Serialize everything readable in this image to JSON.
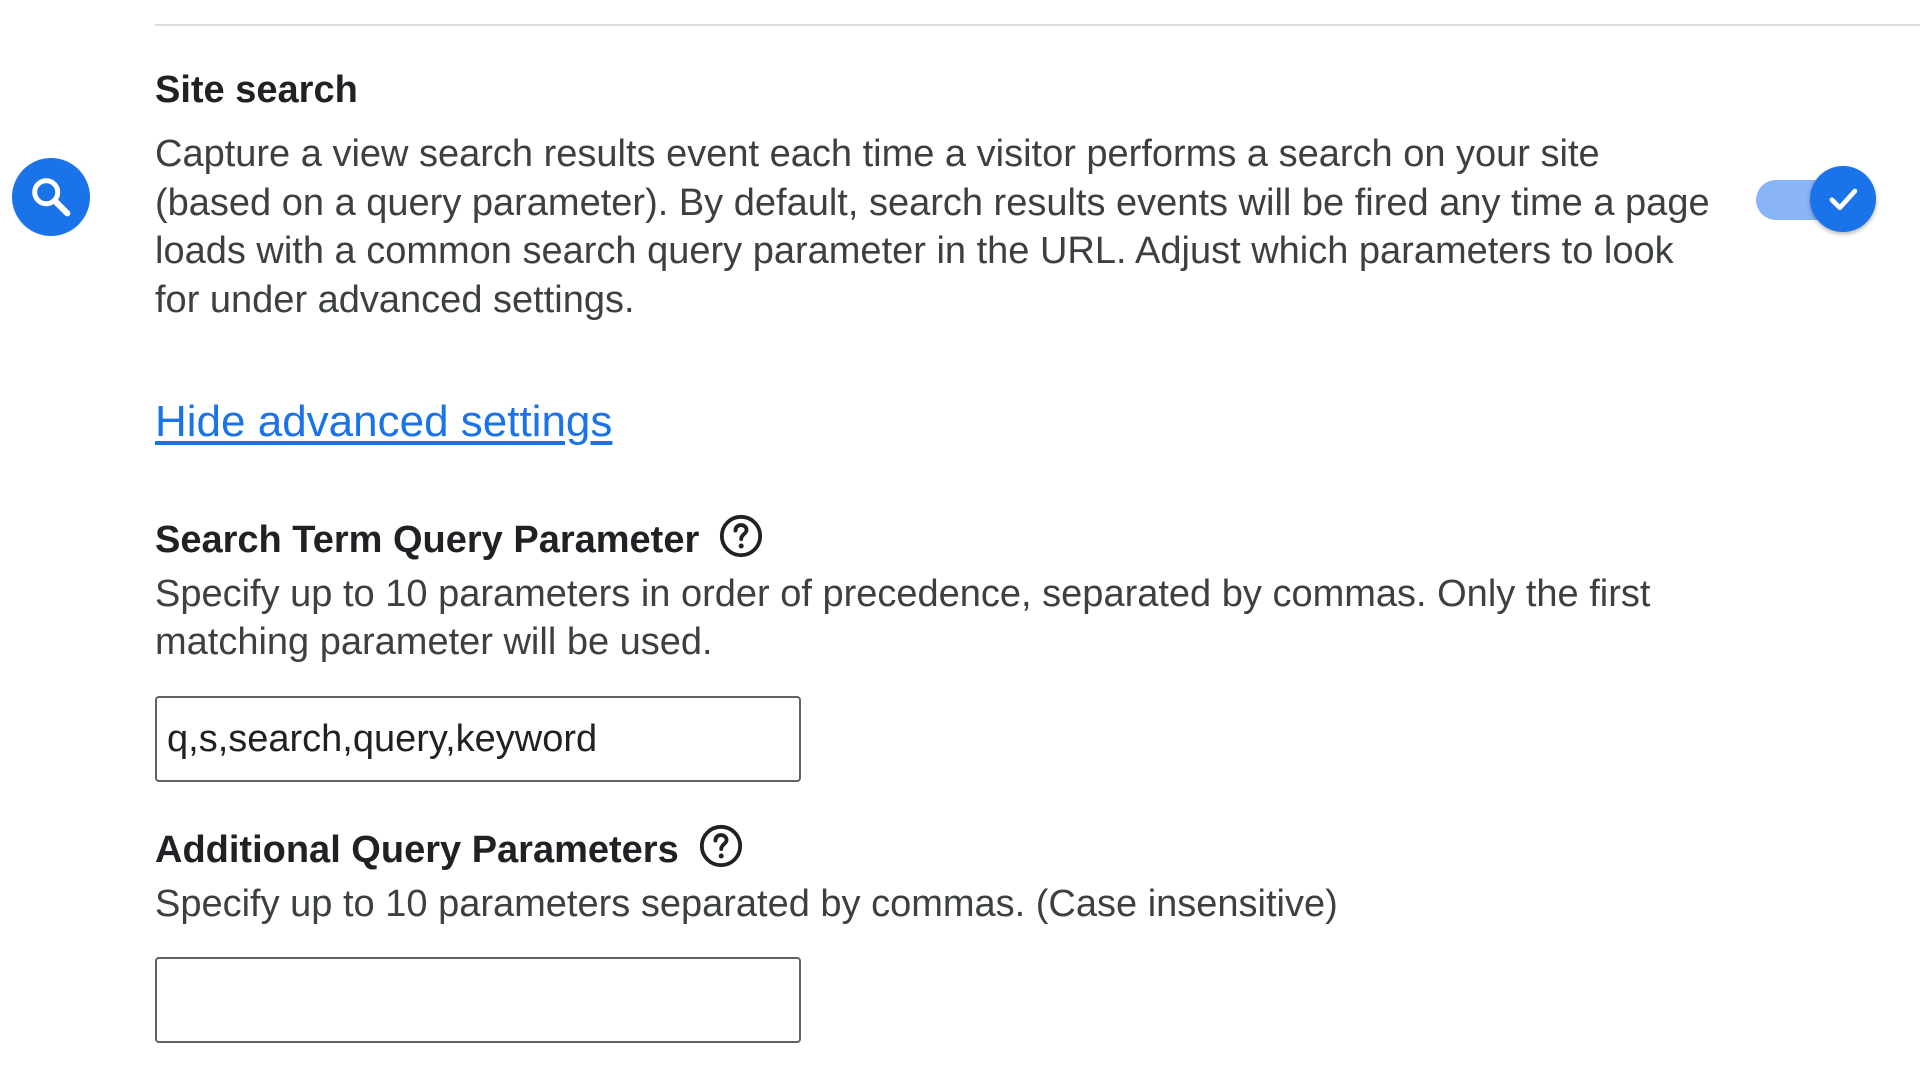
{
  "site_search": {
    "title": "Site search",
    "description": "Capture a view search results event each time a visitor performs a search on your site (based on a query parameter). By default, search results events will be fired any time a page loads with a common search query parameter in the URL. Adjust which parameters to look for under advanced settings.",
    "icon": "search-icon",
    "toggle_on": true,
    "accent_color": "#1a73e8"
  },
  "advanced_link": "Hide advanced settings",
  "search_term_param": {
    "label": "Search Term Query Parameter",
    "description": "Specify up to 10 parameters in order of precedence, separated by commas. Only the first matching parameter will be used.",
    "value": "q,s,search,query,keyword",
    "help_icon": "help-circle-icon"
  },
  "additional_params": {
    "label": "Additional Query Parameters",
    "description": "Specify up to 10 parameters separated by commas. (Case insensitive)",
    "value": "",
    "help_icon": "help-circle-icon"
  }
}
